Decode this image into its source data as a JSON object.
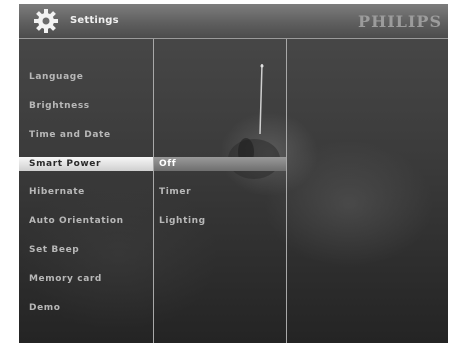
{
  "header": {
    "title": "Settings",
    "brand": "PHILIPS"
  },
  "menu": {
    "items": [
      "Language",
      "Brightness",
      "Time and Date",
      "Smart Power",
      "Hibernate",
      "Auto Orientation",
      "Set Beep",
      "Memory card",
      "Demo"
    ],
    "selected": "Smart Power"
  },
  "submenu": {
    "items": [
      "Off",
      "Timer",
      "Lighting"
    ],
    "selected": "Off"
  }
}
